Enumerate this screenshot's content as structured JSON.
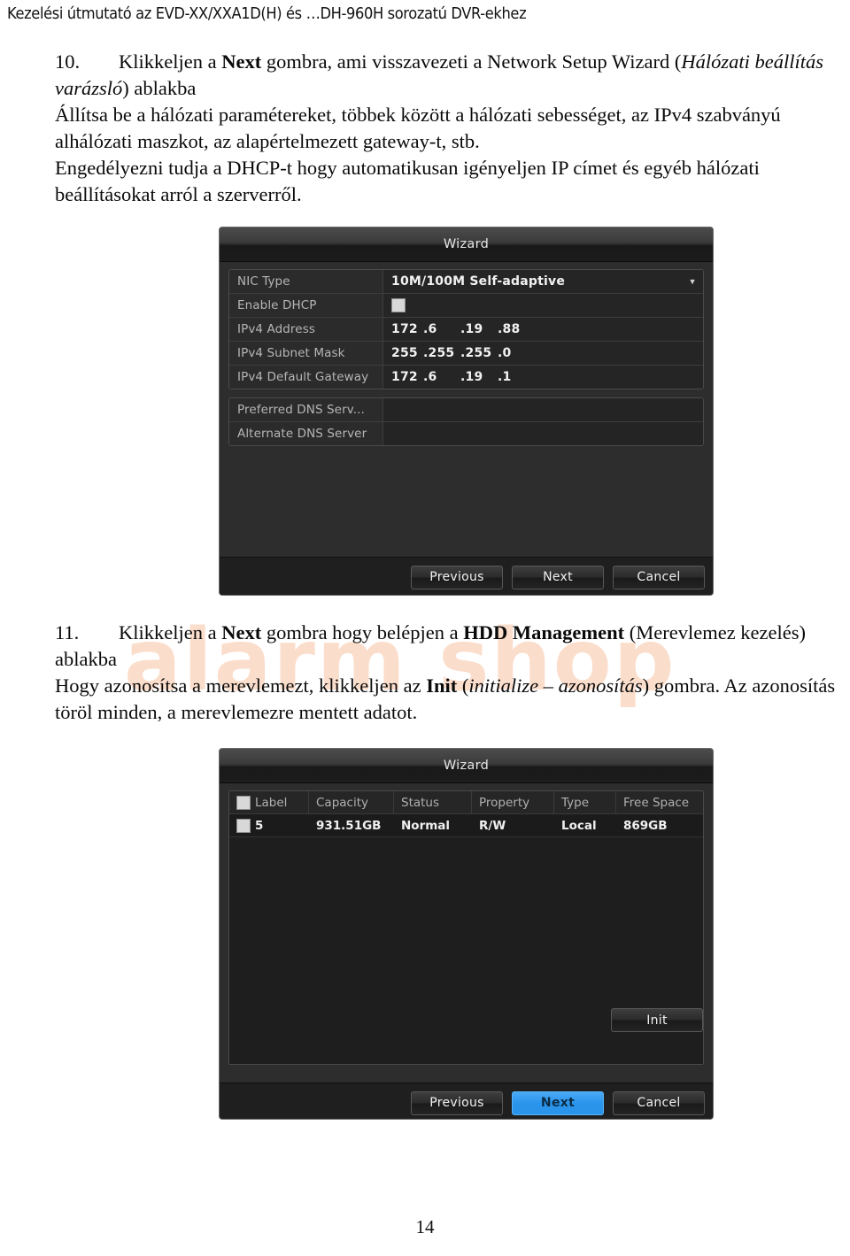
{
  "document": {
    "running_header": "Kezelési útmutató az EVD-XX/XXA1D(H) és …DH-960H sorozatú DVR-ekhez",
    "page_number": "14",
    "watermark": "alarm shop",
    "watermark_color": "#fbddcb"
  },
  "step10": {
    "number": "10.",
    "line1_a": "Klikkeljen a ",
    "line1_bold": "Next",
    "line1_b": " gombra, ami visszavezeti a Network Setup Wizard (",
    "line1_italic": "Hálózati beállítás varázsló",
    "line1_c": ") ablakba",
    "para2": "Állítsa be a hálózati paramétereket, többek között a hálózati sebességet, az IPv4 szabványú alhálózati maszkot, az alapértelmezett gateway-t, stb.",
    "para3": "Engedélyezni tudja a DHCP-t hogy automatikusan igényeljen IP címet és egyéb hálózati beállításokat arról a szerverről."
  },
  "step11": {
    "number": "11.",
    "line1_a": "Klikkeljen a ",
    "line1_bold1": "Next",
    "line1_b": " gombra hogy belépjen a ",
    "line1_bold2": "HDD Management",
    "line1_c": " (Merevlemez kezelés) ablakba",
    "para2_a": "Hogy azonosítsa a merevlemezt, klikkeljen az ",
    "para2_bold": "Init",
    "para2_b": " (",
    "para2_italic": "initialize – azonosítás",
    "para2_c": ") gombra. Az azonosítás töröl minden, a merevlemezre mentett adatot."
  },
  "network_wizard": {
    "title": "Wizard",
    "fields": [
      {
        "label": "NIC Type",
        "value": "10M/100M Self-adaptive",
        "type": "dropdown"
      },
      {
        "label": "Enable DHCP",
        "value": "",
        "type": "checkbox",
        "checked": false
      },
      {
        "label": "IPv4 Address",
        "type": "ip",
        "octets": [
          "172",
          "6",
          "19",
          "88"
        ]
      },
      {
        "label": "IPv4 Subnet Mask",
        "type": "ip",
        "octets": [
          "255",
          "255",
          "255",
          "0"
        ]
      },
      {
        "label": "IPv4 Default Gateway",
        "type": "ip",
        "octets": [
          "172",
          "6",
          "19",
          "1"
        ]
      }
    ],
    "dns_fields": [
      {
        "label": "Preferred DNS Serv...",
        "value": ""
      },
      {
        "label": "Alternate DNS Server",
        "value": ""
      }
    ],
    "buttons": [
      {
        "label": "Previous",
        "primary": false
      },
      {
        "label": "Next",
        "primary": false
      },
      {
        "label": "Cancel",
        "primary": false
      }
    ]
  },
  "hdd_wizard": {
    "title": "Wizard",
    "columns": [
      "Label",
      "Capacity",
      "Status",
      "Property",
      "Type",
      "Free Space"
    ],
    "rows": [
      {
        "label": "5",
        "capacity": "931.51GB",
        "status": "Normal",
        "property": "R/W",
        "type": "Local",
        "free_space": "869GB",
        "checked": false
      }
    ],
    "init_button": "Init",
    "buttons": [
      {
        "label": "Previous",
        "primary": false
      },
      {
        "label": "Next",
        "primary": true
      },
      {
        "label": "Cancel",
        "primary": false
      }
    ],
    "accent_color": "#2a95ec"
  }
}
